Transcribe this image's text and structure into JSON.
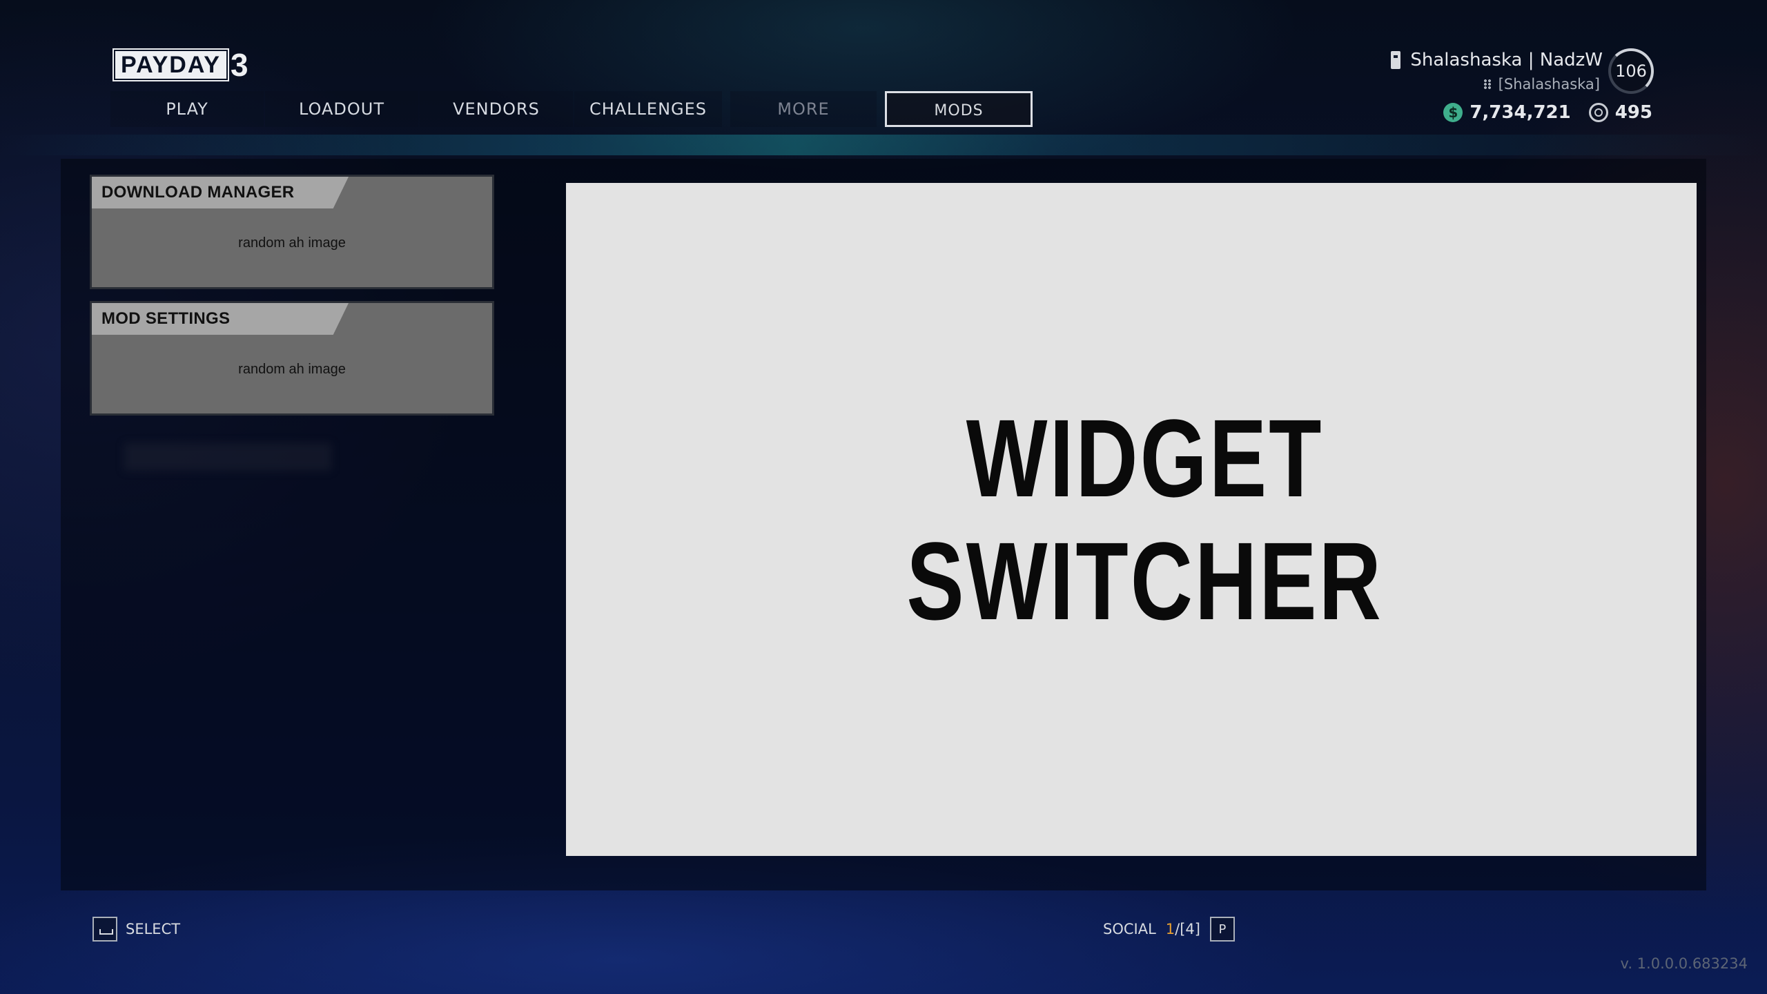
{
  "logo": {
    "word": "PAYDAY",
    "number": "3"
  },
  "nav": {
    "tabs": [
      {
        "label": "PLAY",
        "state": "normal"
      },
      {
        "label": "LOADOUT",
        "state": "normal"
      },
      {
        "label": "VENDORS",
        "state": "normal"
      },
      {
        "label": "CHALLENGES",
        "state": "normal"
      },
      {
        "label": "MORE",
        "state": "disabled"
      },
      {
        "label": "MODS",
        "state": "active"
      }
    ]
  },
  "profile": {
    "display_name": "Shalashaska | NadzW",
    "platform_name": "[Shalashaska]",
    "level": "106",
    "cash": "7,734,721",
    "c_stacks": "495"
  },
  "cards": [
    {
      "title": "DOWNLOAD MANAGER",
      "body": "random ah image"
    },
    {
      "title": "MOD SETTINGS",
      "body": "random ah image"
    }
  ],
  "preview": {
    "line1": "WIDGET",
    "line2": "SWITCHER",
    "background": "#e3e3e3"
  },
  "footer": {
    "select_label": "SELECT",
    "social_label": "SOCIAL",
    "social_online": "1",
    "social_total": "/[4]",
    "social_key": "P",
    "version": "v. 1.0.0.0.683234"
  },
  "colors": {
    "accent_cash": "#3fae8c",
    "social_highlight": "#e8a030"
  }
}
